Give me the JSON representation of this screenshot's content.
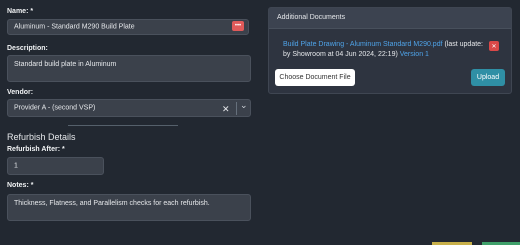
{
  "form": {
    "name_label": "Name: *",
    "name_value": "Aluminum - Standard M290 Build Plate",
    "name_clear_glyph": "•••",
    "description_label": "Description:",
    "description_value": "Standard build plate in Aluminum",
    "vendor_label": "Vendor:",
    "vendor_value": "Provider A - (second VSP)",
    "vendor_clear_glyph": "✕",
    "vendor_chevron_glyph": "⌄",
    "refurbish_section_title": "Refurbish Details",
    "refurbish_after_label": "Refurbish After: *",
    "refurbish_after_value": "1",
    "notes_label": "Notes: *",
    "notes_value": "Thickness, Flatness, and Parallelism checks for each refurbish."
  },
  "documents": {
    "title": "Additional Documents",
    "doc_link": "Build Plate Drawing - Aluminum Standard M290.pdf",
    "doc_meta": " (last update: by Showroom at 04 Jun 2024, 22:19) ",
    "version_link": "Version 1",
    "delete_glyph": "✕",
    "choose_label": "Choose Document File",
    "upload_label": "Upload"
  },
  "colors": {
    "background": "#222831",
    "field": "#3b414b",
    "link": "#4fa3e8",
    "danger": "#e05a5a",
    "upload": "#2f8fa5"
  }
}
